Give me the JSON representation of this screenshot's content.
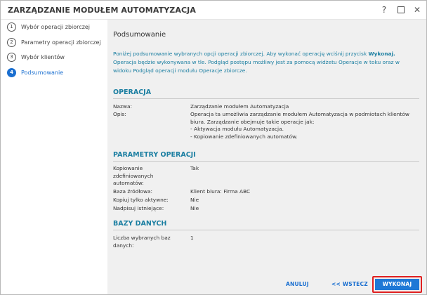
{
  "window": {
    "title": "ZARZĄDZANIE MODUŁEM AUTOMATYZACJA",
    "help_glyph": "?",
    "close_glyph": "✕"
  },
  "steps": [
    {
      "num": "1",
      "label": "Wybór operacji zbiorczej",
      "active": false
    },
    {
      "num": "2",
      "label": "Parametry operacji zbiorczej",
      "active": false
    },
    {
      "num": "3",
      "label": "Wybór klientów",
      "active": false
    },
    {
      "num": "4",
      "label": "Podsumowanie",
      "active": true
    }
  ],
  "main": {
    "title": "Podsumowanie",
    "info_before": "Poniżej podsumowanie wybranych opcji operacji zbiorczej. Aby wykonać operację wciśnij przycisk ",
    "info_bold": "Wykonaj.",
    "info_after": " Operacja będzie wykonywana w tle. Podgląd postępu możliwy jest za pomocą widżetu Operacje w toku oraz w widoku Podgląd operacji modułu Operacje zbiorcze."
  },
  "sections": {
    "operacja": {
      "heading": "OPERACJA",
      "nazwa_label": "Nazwa:",
      "nazwa_value": "Zarządzanie modułem Automatyzacja",
      "opis_label": "Opis:",
      "opis_lines": [
        "Operacja ta umożliwia zarządzanie modułem Automatyzacja w podmiotach klientów",
        "biura. Zarządzanie obejmuje takie operacje jak:",
        "- Aktywacja modułu Automatyzacja.",
        "- Kopiowanie zdefiniowanych automatów."
      ]
    },
    "parametry": {
      "heading": "PARAMETRY OPERACJI",
      "rows": [
        {
          "label_lines": [
            "Kopiowanie",
            "zdefiniowanych",
            "automatów:"
          ],
          "value": "Tak"
        },
        {
          "label_lines": [
            "Baza źródłowa:"
          ],
          "value": "Klient biura: Firma ABC"
        },
        {
          "label_lines": [
            "Kopiuj tylko aktywne:"
          ],
          "value": "Nie"
        },
        {
          "label_lines": [
            "Nadpisuj istniejące:"
          ],
          "value": "Nie"
        }
      ]
    },
    "bazy": {
      "heading": "BAZY DANYCH",
      "rows": [
        {
          "label_lines": [
            "Liczba wybranych baz",
            "danych:"
          ],
          "value": "1"
        }
      ]
    }
  },
  "footer": {
    "cancel_label": "ANULUJ",
    "back_label": "<< WSTECZ",
    "execute_label": "WYKONAJ"
  }
}
